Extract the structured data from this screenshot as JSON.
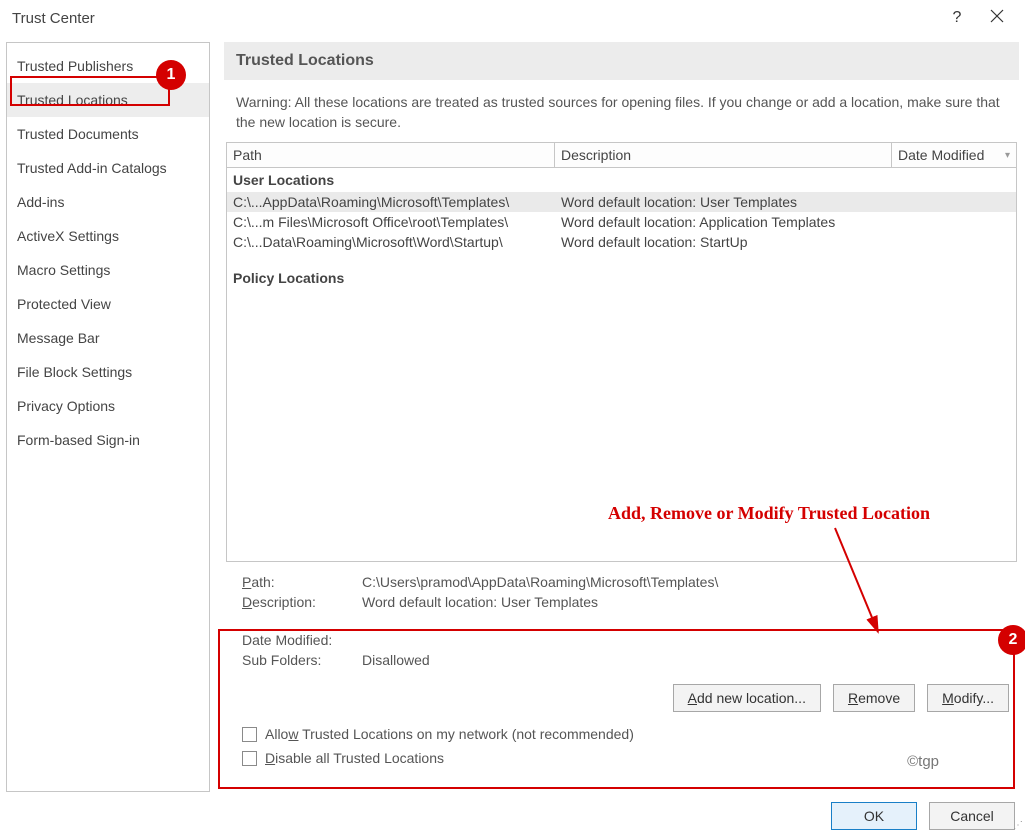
{
  "title": "Trust Center",
  "nav": [
    "Trusted Publishers",
    "Trusted Locations",
    "Trusted Documents",
    "Trusted Add-in Catalogs",
    "Add-ins",
    "ActiveX Settings",
    "Macro Settings",
    "Protected View",
    "Message Bar",
    "File Block Settings",
    "Privacy Options",
    "Form-based Sign-in"
  ],
  "nav_selected_index": 1,
  "group_title": "Trusted Locations",
  "warning_text": "Warning: All these locations are treated as trusted sources for opening files.  If you change or add a location, make sure that the new location is secure.",
  "columns": {
    "path": "Path",
    "desc": "Description",
    "date": "Date Modified"
  },
  "sections": {
    "user": "User Locations",
    "policy": "Policy Locations"
  },
  "rows": [
    {
      "path": "C:\\...AppData\\Roaming\\Microsoft\\Templates\\",
      "desc": "Word default location: User Templates",
      "selected": true
    },
    {
      "path": "C:\\...m Files\\Microsoft Office\\root\\Templates\\",
      "desc": "Word default location: Application Templates",
      "selected": false
    },
    {
      "path": "C:\\...Data\\Roaming\\Microsoft\\Word\\Startup\\",
      "desc": "Word default location: StartUp",
      "selected": false
    }
  ],
  "details": {
    "path_label": "Path:",
    "path_value": "C:\\Users\\pramod\\AppData\\Roaming\\Microsoft\\Templates\\",
    "desc_label": "Description:",
    "desc_value": "Word default location: User Templates",
    "date_label": "Date Modified:",
    "date_value": "",
    "sub_label": "Sub Folders:",
    "sub_value": "Disallowed"
  },
  "buttons": {
    "add": "Add new location...",
    "remove": "Remove",
    "modify": "Modify..."
  },
  "checkboxes": {
    "network": "Allow Trusted Locations on my network (not recommended)",
    "disable": "Disable all Trusted Locations"
  },
  "footer": {
    "ok": "OK",
    "cancel": "Cancel"
  },
  "annotation": {
    "text": "Add, Remove or Modify Trusted Location",
    "badge1": "1",
    "badge2": "2"
  },
  "watermark": "©tgp"
}
